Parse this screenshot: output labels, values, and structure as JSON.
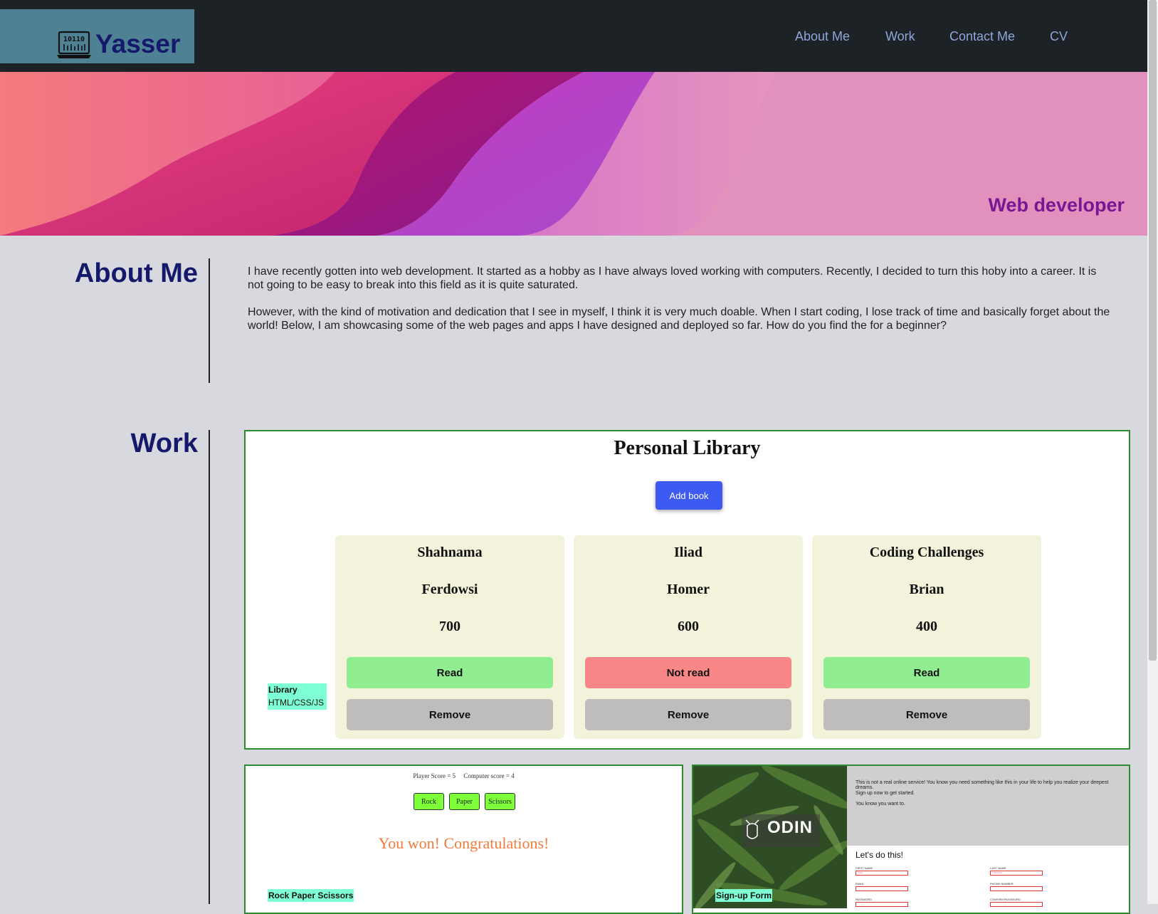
{
  "header": {
    "logo_text": "Yasser",
    "nav": [
      "About Me",
      "Work",
      "Contact Me",
      "CV"
    ]
  },
  "hero": {
    "tagline": "Web developer"
  },
  "about": {
    "title": "About Me",
    "paragraphs": [
      "I have recently gotten into web development. It started as a hobby as I have always loved working with computers. Recently, I decided to turn this hoby into a career. It is not going to be easy to break into this field as it is quite saturated.",
      "However, with the kind of motivation and dedication that I see in myself, I think it is very much doable. When I start coding, I lose track of time and basically forget about the world! Below, I am showcasing some of the web pages and apps I have designed and deployed so far. How do you find the for a beginner?"
    ]
  },
  "work": {
    "title": "Work",
    "library": {
      "title": "Personal Library",
      "add_button": "Add book",
      "books": [
        {
          "title": "Shahnama",
          "author": "Ferdowsi",
          "pages": "700",
          "status": "Read",
          "remove": "Remove"
        },
        {
          "title": "Iliad",
          "author": "Homer",
          "pages": "600",
          "status": "Not read",
          "remove": "Remove"
        },
        {
          "title": "Coding Challenges",
          "author": "Brian",
          "pages": "400",
          "status": "Read",
          "remove": "Remove"
        }
      ],
      "tag_name": "Library",
      "tag_tech": "HTML/CSS/JS"
    },
    "rps": {
      "score": "Player Score = 5     Computer score = 4",
      "buttons": [
        "Rock",
        "Paper",
        "Scissors"
      ],
      "result": "You won! Congratulations!",
      "tag_name": "Rock Paper Scissors"
    },
    "signup": {
      "brand": "ODIN",
      "intro": [
        "This is not a real online service! You know you need something like this in your life to help you realize your deepest dreams.",
        "Sign up now to get started.",
        "You know you want to."
      ],
      "heading": "Let's do this!",
      "fields": {
        "first_name": "FIRST NAME",
        "last_name": "LAST NAME",
        "email": "EMAIL",
        "phone": "PHONE NUMBER",
        "password": "PASSWORD",
        "confirm": "CONFIRM PASSWORD",
        "first_ph": "Thor",
        "last_ph": "Odinson"
      },
      "tag_name": "Sign-up Form"
    }
  },
  "colors": {
    "header_bg": "#1d2226",
    "logo_bg": "#4f8195",
    "title_color": "#14196b",
    "read_color": "#90ee90",
    "not_read_color": "#fa8787",
    "accent_border": "#2d8a2f"
  }
}
